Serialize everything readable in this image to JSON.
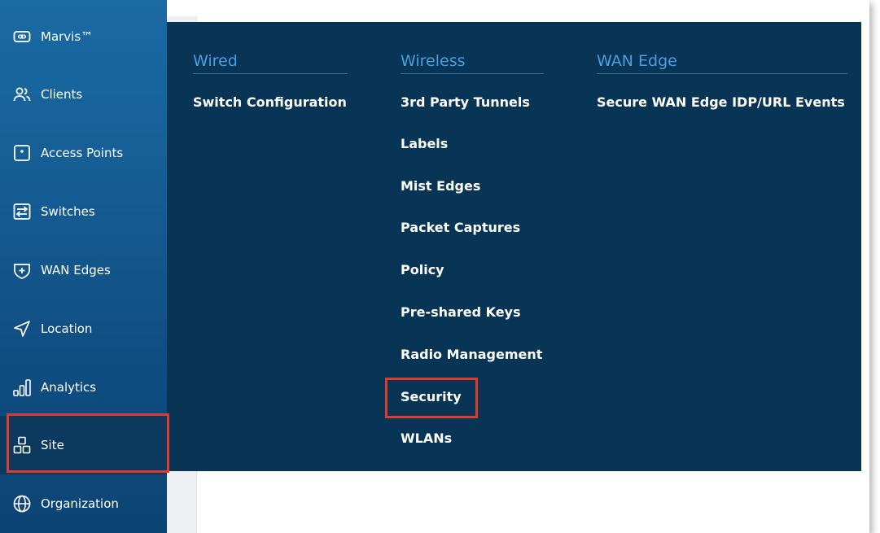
{
  "sidebar": {
    "items": [
      {
        "label": "Marvis™",
        "icon": "marvis-icon"
      },
      {
        "label": "Clients",
        "icon": "clients-icon"
      },
      {
        "label": "Access Points",
        "icon": "access-point-icon"
      },
      {
        "label": "Switches",
        "icon": "switch-icon"
      },
      {
        "label": "WAN Edges",
        "icon": "wan-edge-icon"
      },
      {
        "label": "Location",
        "icon": "location-arrow-icon"
      },
      {
        "label": "Analytics",
        "icon": "analytics-bars-icon"
      },
      {
        "label": "Site",
        "icon": "site-grid-icon"
      },
      {
        "label": "Organization",
        "icon": "globe-icon"
      }
    ]
  },
  "menu": {
    "columns": [
      {
        "heading": "Wired",
        "items": [
          "Switch Configuration"
        ]
      },
      {
        "heading": "Wireless",
        "items": [
          "3rd Party Tunnels",
          "Labels",
          "Mist Edges",
          "Packet Captures",
          "Policy",
          "Pre-shared Keys",
          "Radio Management",
          "Security",
          "WLANs"
        ]
      },
      {
        "heading": "WAN Edge",
        "items": [
          "Secure WAN Edge IDP/URL Events"
        ]
      }
    ]
  },
  "colors": {
    "sidebar_top": "#1a6aa4",
    "sidebar_bottom": "#0c4474",
    "menu_background": "#083456",
    "menu_heading": "#4a9fe0",
    "highlight": "#e03a2f"
  }
}
